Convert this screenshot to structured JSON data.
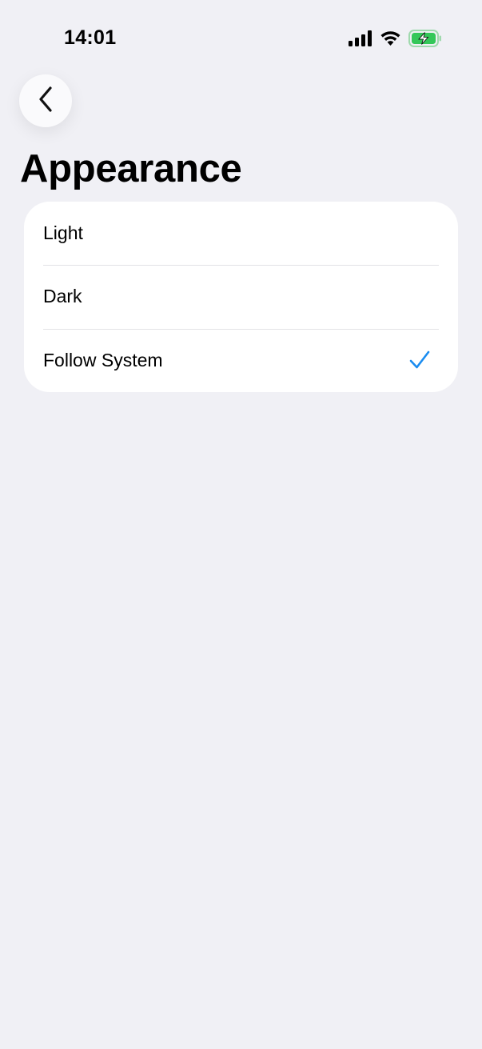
{
  "status_bar": {
    "time": "14:01",
    "icons": [
      "cellular-signal-icon",
      "wifi-icon",
      "battery-charging-icon"
    ]
  },
  "nav": {
    "back_icon": "chevron-left-icon"
  },
  "page": {
    "title": "Appearance"
  },
  "options": [
    {
      "label": "Light",
      "selected": false
    },
    {
      "label": "Dark",
      "selected": false
    },
    {
      "label": "Follow System",
      "selected": true
    }
  ],
  "colors": {
    "background": "#f0f0f5",
    "card": "#ffffff",
    "accent": "#1a8cf0",
    "battery_green": "#34c759"
  }
}
